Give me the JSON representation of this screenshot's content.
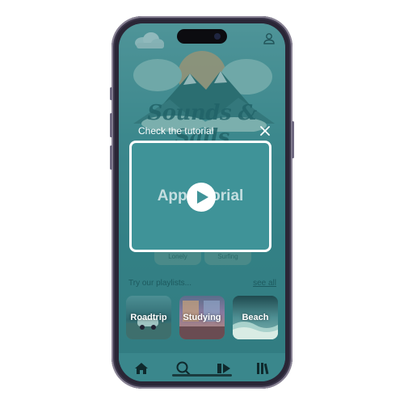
{
  "app": {
    "title": "Sounds & Sails"
  },
  "tutorial": {
    "heading": "Check the tutorial",
    "video_label": "App tutorial"
  },
  "moods": [
    {
      "label": "Lonely"
    },
    {
      "label": "Surfing"
    }
  ],
  "playlists_section": {
    "label": "Try our playlists...",
    "see_all": "see all",
    "items": [
      {
        "label": "Roadtrip"
      },
      {
        "label": "Studying"
      },
      {
        "label": "Beach"
      }
    ]
  },
  "tabbar": {
    "items": [
      {
        "icon": "home-icon"
      },
      {
        "icon": "search-icon"
      },
      {
        "icon": "player-icon"
      },
      {
        "icon": "library-icon"
      }
    ]
  },
  "colors": {
    "accent": "#3f9398",
    "dark_teal": "#1d5a5f",
    "phone_frame": "#2a2636"
  }
}
